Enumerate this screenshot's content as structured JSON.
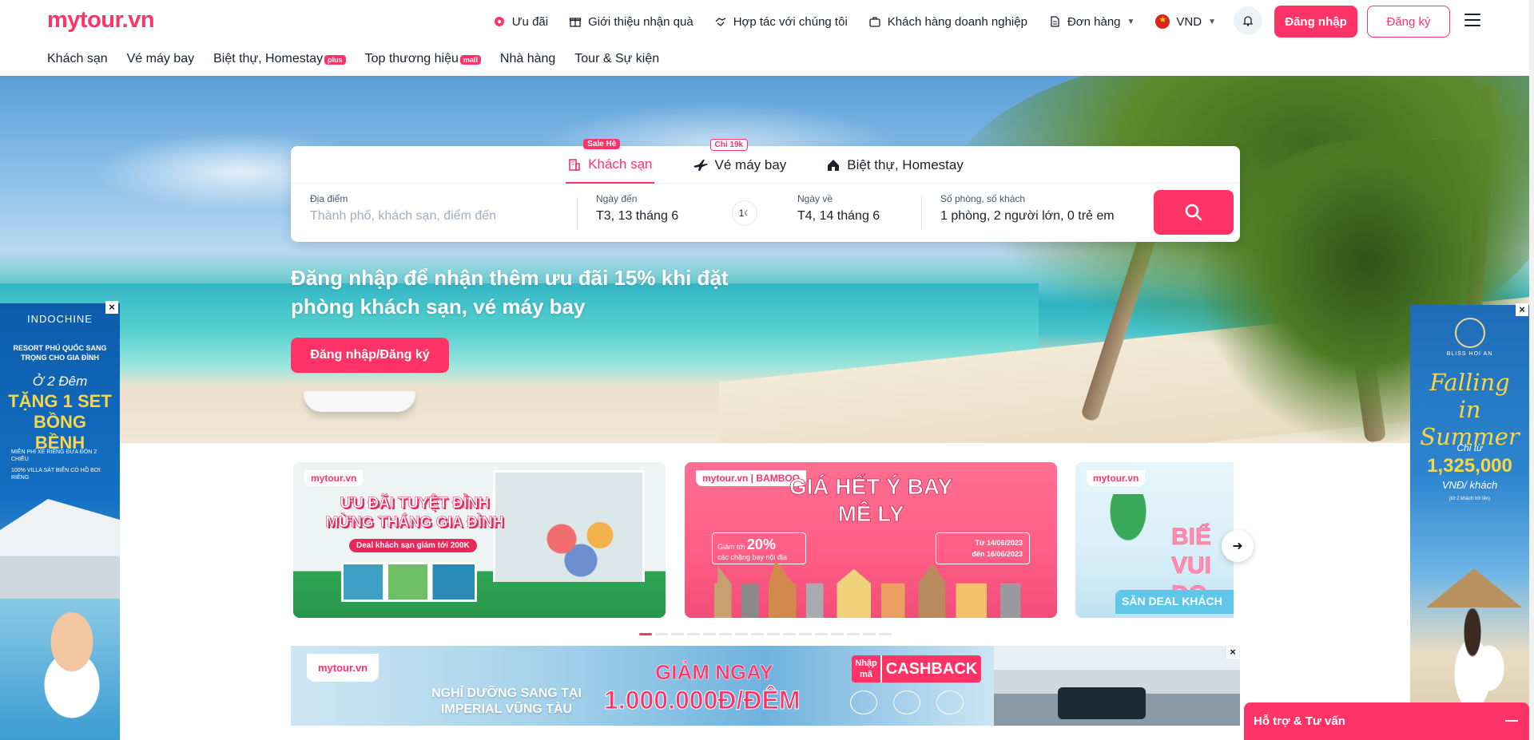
{
  "header": {
    "logo": "mytour.vn",
    "links": [
      {
        "label": "Ưu đãi",
        "icon": "gift-badge-icon"
      },
      {
        "label": "Giới thiệu nhận quà",
        "icon": "gift-box-icon"
      },
      {
        "label": "Hợp tác với chúng tôi",
        "icon": "handshake-icon"
      },
      {
        "label": "Khách hàng doanh nghiệp",
        "icon": "briefcase-icon"
      },
      {
        "label": "Đơn hàng",
        "icon": "document-icon"
      },
      {
        "label": "VND",
        "icon": "vietnam-flag-icon"
      }
    ],
    "login": "Đăng nhập",
    "register": "Đăng ký"
  },
  "catnav": [
    {
      "label": "Khách sạn",
      "tag": ""
    },
    {
      "label": "Vé máy bay",
      "tag": ""
    },
    {
      "label": "Biệt thự, Homestay",
      "tag": "plus"
    },
    {
      "label": "Top thương hiệu",
      "tag": "mall"
    },
    {
      "label": "Nhà hàng",
      "tag": ""
    },
    {
      "label": "Tour & Sự kiện",
      "tag": ""
    }
  ],
  "search": {
    "tabs": [
      {
        "label": "Khách sạn",
        "badge": "Sale Hè"
      },
      {
        "label": "Vé máy bay",
        "badge": "Chỉ 19k"
      },
      {
        "label": "Biệt thự, Homestay",
        "badge": ""
      }
    ],
    "location_label": "Địa điểm",
    "location_placeholder": "Thành phố, khách sạn, điểm đến",
    "checkin_label": "Ngày đến",
    "checkin_value": "T3, 13 tháng 6",
    "nights": "1",
    "checkout_label": "Ngày về",
    "checkout_value": "T4, 14 tháng 6",
    "guests_label": "Số phòng, số khách",
    "guests_value": "1 phòng, 2 người lớn, 0 trẻ em"
  },
  "hero": {
    "text": "Đăng nhập để nhận thêm ưu đãi 15% khi đặt phòng khách sạn, vé máy bay",
    "button": "Đăng nhập/Đăng ký"
  },
  "promos": {
    "p1_brand": "mytour.vn",
    "p1_title": "ƯU ĐÃI TUYỆT ĐỈNH MỪNG THÁNG GIA ĐÌNH",
    "p1_pill": "Deal khách sạn giảm tới 200K",
    "p2_brand": "mytour.vn | BAMBOO",
    "p2_title": "GIÁ HẾT Ý BAY MÊ LY",
    "p2_discount_text": "Giảm tới",
    "p2_discount": "20%",
    "p2_discount_sub": "các chặng bay nội địa",
    "p2_date1": "Từ 14/06/2023",
    "p2_date2": "đến 16/06/2023",
    "p3_brand": "mytour.vn",
    "p3_title": "BIỂ VUI ĐỌ",
    "p3_deal": "SĂN DEAL KHÁCH"
  },
  "slider_dots": 16,
  "bottom_banner": {
    "brand": "mytour.vn",
    "left": "NGHỈ DƯỠNG SANG TẠI IMPERIAL VŨNG TÀU",
    "line1": "GIẢM NGAY",
    "line2": "1.000.000Đ/ĐÊM",
    "code": "Nhập mã",
    "cashback": "CASHBACK"
  },
  "ad_left": {
    "brand": "INDOCHINE",
    "sub": "RESORT PHÚ QUỐC SANG TRỌNG CHO GIA ĐÌNH",
    "o2": "Ở 2 Đêm",
    "tang": "TẶNG 1 SET BỒNG BỀNH",
    "b1": "MIỄN PHÍ XE RIÊNG ĐƯA ĐÓN 2 CHIỀU",
    "b2": "100% VILLA SÁT BIỂN CÓ HỒ BƠI RIÊNG"
  },
  "ad_right": {
    "brand": "BLISS HOI AN",
    "falling": "Falling in Summer",
    "chitu": "Chỉ từ",
    "price": "1,325,000",
    "unit": "VNĐ/ khách",
    "note": "(từ 2 khách trở lên)"
  },
  "support": "Hỗ trợ & Tư vấn",
  "colors": {
    "brand": "#ff3366"
  }
}
